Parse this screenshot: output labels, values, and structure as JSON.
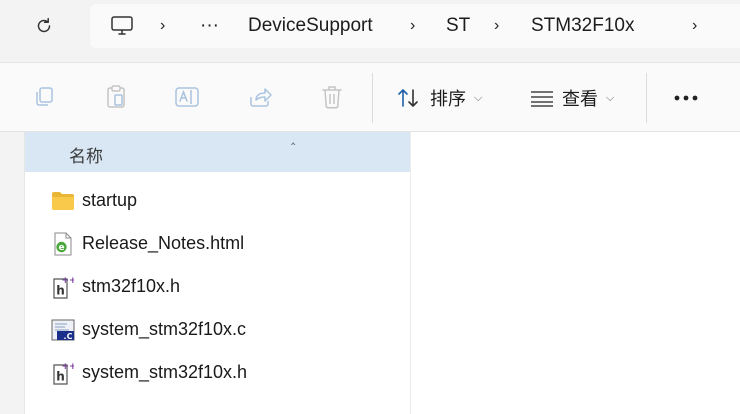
{
  "address_bar": {
    "overflow": "···",
    "crumbs": [
      "DeviceSupport",
      "ST",
      "STM32F10x"
    ]
  },
  "toolbar": {
    "sort_label": "排序",
    "view_label": "查看",
    "more_label": "···"
  },
  "file_list": {
    "column_header": "名称",
    "files": [
      {
        "name": "startup",
        "icon": "folder-icon"
      },
      {
        "name": "Release_Notes.html",
        "icon": "html-file-icon"
      },
      {
        "name": "stm32f10x.h",
        "icon": "h-file-icon"
      },
      {
        "name": "system_stm32f10x.c",
        "icon": "c-file-icon"
      },
      {
        "name": "system_stm32f10x.h",
        "icon": "h-file-icon"
      }
    ]
  },
  "colors": {
    "accent_header": "#d9e7f5",
    "folder": "#f8c94a",
    "sort_icon": "#1f5fa8"
  }
}
